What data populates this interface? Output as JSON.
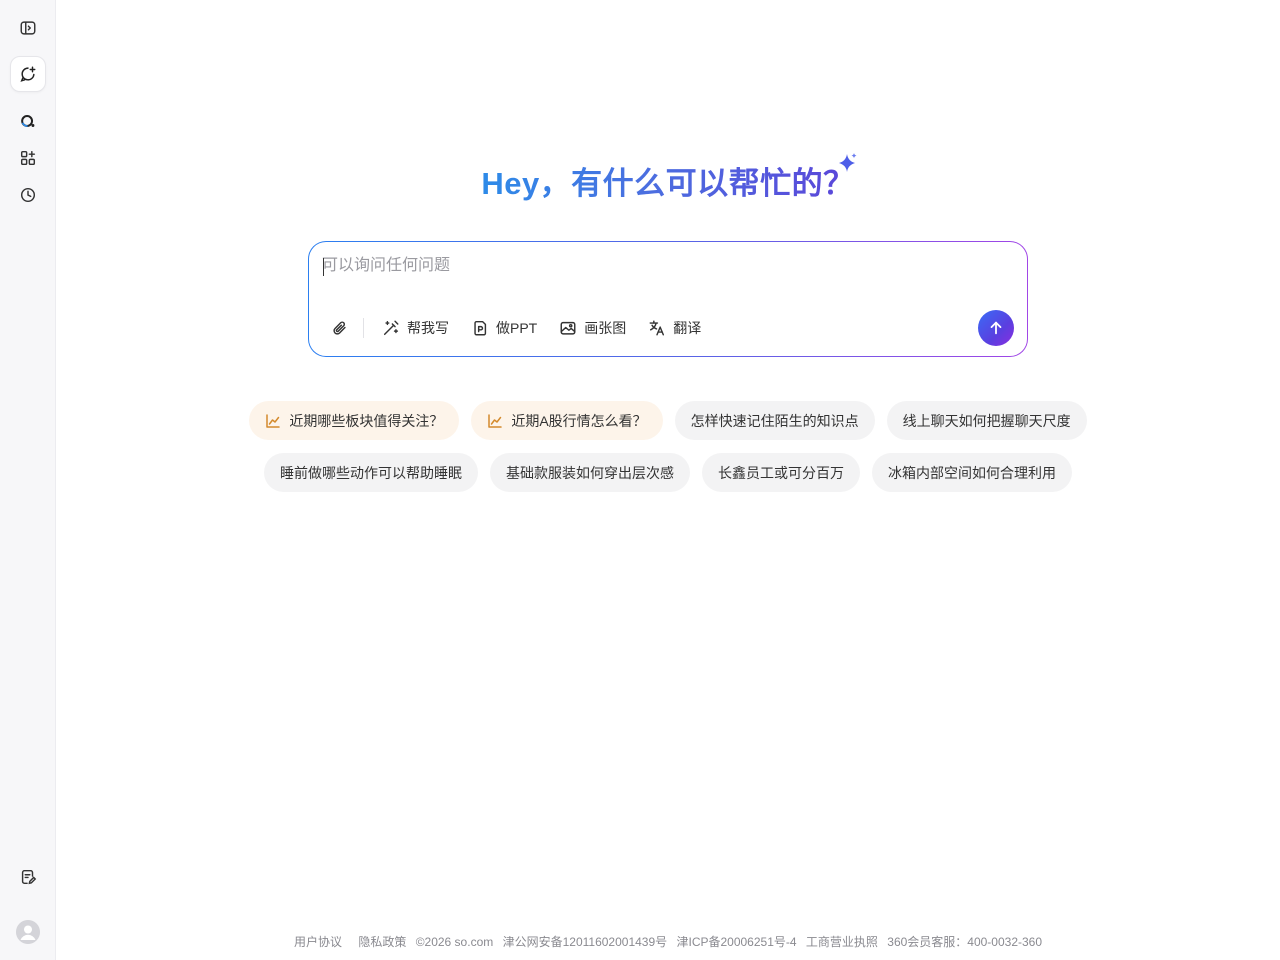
{
  "sidebar": {
    "items": [
      {
        "icon": "sidebar-toggle-icon"
      },
      {
        "icon": "new-chat-icon",
        "active": true
      },
      {
        "icon": "search-logo-icon"
      },
      {
        "icon": "apps-icon"
      },
      {
        "icon": "history-icon"
      }
    ],
    "bottom": [
      {
        "icon": "notes-icon"
      },
      {
        "icon": "user-avatar-icon"
      }
    ]
  },
  "hero": {
    "title": "Hey，有什么可以帮忙的？"
  },
  "composer": {
    "placeholder": "可以询问任何问题",
    "tools": {
      "write": "帮我写",
      "ppt": "做PPT",
      "image": "画张图",
      "translate": "翻译"
    }
  },
  "suggestions": {
    "row1": [
      {
        "label": "近期哪些板块值得关注？",
        "trending": true
      },
      {
        "label": "近期A股行情怎么看？",
        "trending": true
      },
      {
        "label": "怎样快速记住陌生的知识点",
        "trending": false
      },
      {
        "label": "线上聊天如何把握聊天尺度",
        "trending": false
      }
    ],
    "row2": [
      {
        "label": "睡前做哪些动作可以帮助睡眠"
      },
      {
        "label": "基础款服装如何穿出层次感"
      },
      {
        "label": "长鑫员工或可分百万"
      },
      {
        "label": "冰箱内部空间如何合理利用"
      }
    ]
  },
  "footer": {
    "agreement": "用户协议",
    "privacy": "隐私政策",
    "copyright": "©2026 so.com",
    "police": "津公网安备12011602001439号",
    "icp": "津ICP备20006251号-4",
    "license": "工商营业执照",
    "service": "360会员客服：400-0032-360"
  },
  "colors": {
    "accent_start": "#2d8be8",
    "accent_end": "#5b45d9",
    "trending_chip_bg": "#fdf4ea",
    "trending_icon": "#d48a2c"
  }
}
